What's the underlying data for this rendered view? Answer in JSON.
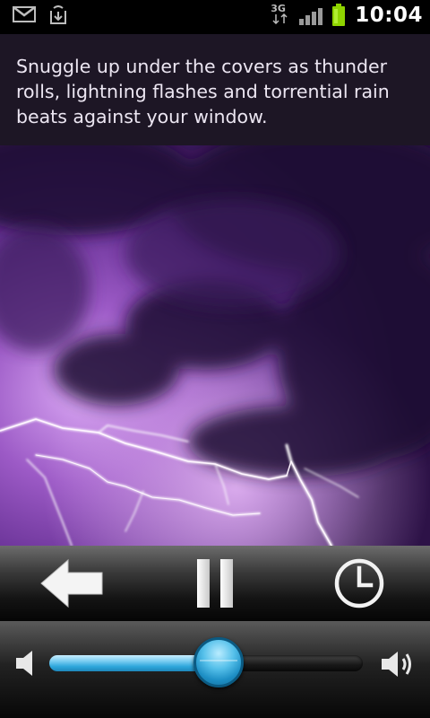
{
  "status_bar": {
    "network_type": "3G",
    "time": "10:04",
    "icons": [
      "gmail-icon",
      "download-icon",
      "3g-data-icon",
      "signal-icon",
      "battery-icon"
    ]
  },
  "description": "Snuggle up under the covers as thunder rolls, lightning flashes and torrential rain beats against your window.",
  "image": {
    "subject": "lightning-storm-photo",
    "tint": "#6a2f9e"
  },
  "controls": {
    "buttons": [
      "back-arrow-icon",
      "pause-icon",
      "timer-clock-icon"
    ]
  },
  "volume": {
    "level": 0.54,
    "fill_color": "#2ea7dc",
    "icons": [
      "volume-low-icon",
      "volume-high-icon"
    ]
  }
}
